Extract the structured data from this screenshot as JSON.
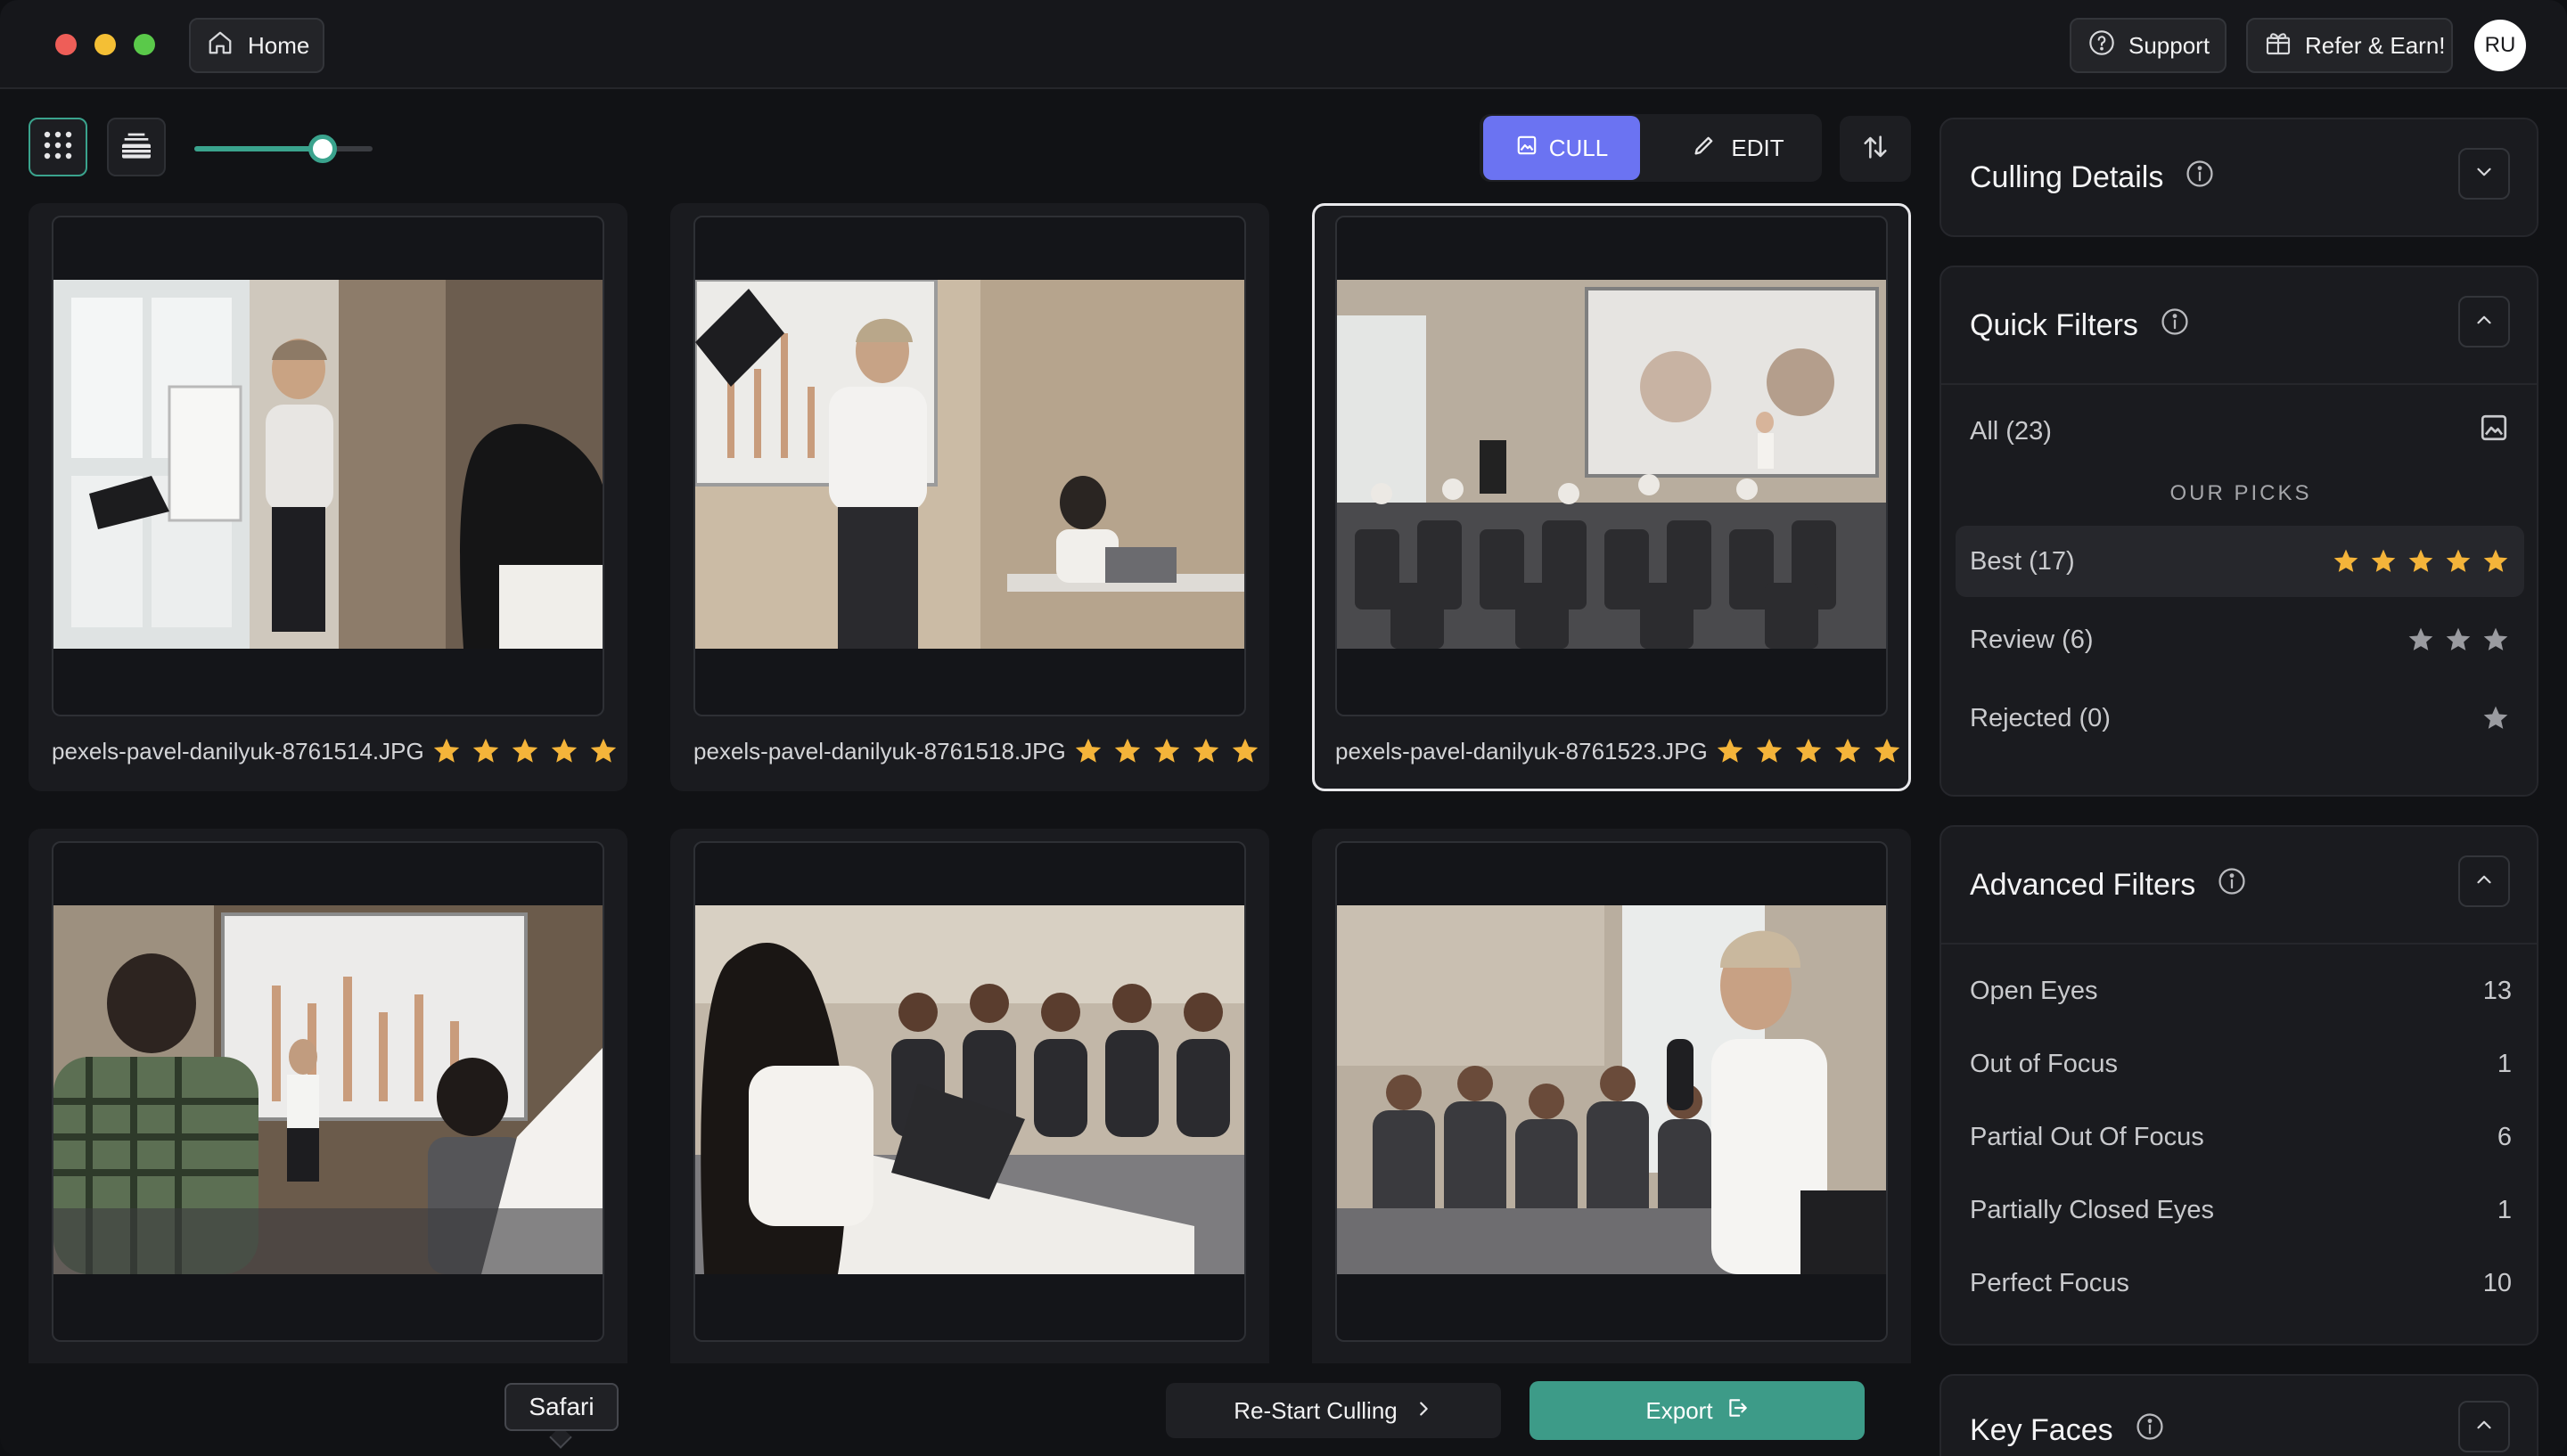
{
  "header": {
    "home_label": "Home",
    "support_label": "Support",
    "refer_label": "Refer & Earn!",
    "avatar_initials": "RU"
  },
  "toolbar": {
    "zoom_level_fraction": 0.72,
    "cull_label": "CULL",
    "edit_label": "EDIT",
    "active_mode": "CULL"
  },
  "photos": [
    {
      "filename": "pexels-pavel-danilyuk-8761514.JPG",
      "stars": 5,
      "selected": false
    },
    {
      "filename": "pexels-pavel-danilyuk-8761518.JPG",
      "stars": 5,
      "selected": false
    },
    {
      "filename": "pexels-pavel-danilyuk-8761523.JPG",
      "stars": 5,
      "selected": true
    },
    {
      "filename": "",
      "stars": 0,
      "selected": false
    },
    {
      "filename": "",
      "stars": 0,
      "selected": false
    },
    {
      "filename": "",
      "stars": 0,
      "selected": false
    }
  ],
  "bottom": {
    "tooltip": "Safari",
    "restart_label": "Re-Start Culling",
    "export_label": "Export"
  },
  "panel": {
    "culling_details": {
      "title": "Culling Details"
    },
    "quick_filters": {
      "title": "Quick Filters",
      "all_label": "All (23)",
      "section_label": "OUR PICKS",
      "items": [
        {
          "label": "Best (17)",
          "stars": 5,
          "active": true
        },
        {
          "label": "Review (6)",
          "stars": 3,
          "active": false
        },
        {
          "label": "Rejected (0)",
          "stars": 1,
          "active": false
        }
      ]
    },
    "advanced_filters": {
      "title": "Advanced Filters",
      "items": [
        {
          "label": "Open Eyes",
          "count": "13"
        },
        {
          "label": "Out of Focus",
          "count": "1"
        },
        {
          "label": "Partial Out Of Focus",
          "count": "6"
        },
        {
          "label": "Partially Closed Eyes",
          "count": "1"
        },
        {
          "label": "Perfect Focus",
          "count": "10"
        }
      ]
    },
    "key_faces": {
      "title": "Key Faces"
    }
  },
  "colors": {
    "accent_teal": "#3d9b88",
    "cull_purple": "#6b73f2",
    "star_gold": "#f4b43a",
    "star_gray": "#9a9ba0"
  }
}
